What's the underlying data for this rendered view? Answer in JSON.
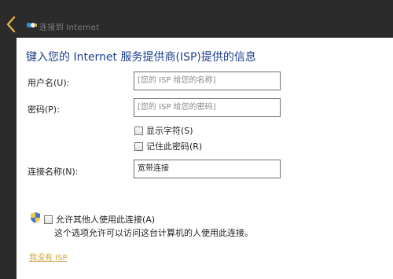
{
  "titlebar": {
    "title": "连接到 Internet"
  },
  "heading": "键入您的 Internet 服务提供商(ISP)提供的信息",
  "form": {
    "username": {
      "label": "用户名(U):",
      "placeholder": "[您的 ISP 给您的名称]"
    },
    "password": {
      "label": "密码(P):",
      "placeholder": "[您的 ISP 给您的密码]"
    },
    "show_chars_label": "显示字符(S)",
    "remember_label": "记住此密码(R)",
    "connection_name": {
      "label": "连接名称(N):",
      "value": "宽带连接"
    }
  },
  "allow_others": {
    "label": "允许其他人使用此连接(A)",
    "note": "这个选项允许可以访问这台计算机的人使用此连接。"
  },
  "no_isp_link": "我没有 ISP",
  "colors": {
    "heading": "#1c3e8c",
    "link": "#d2a442",
    "titlebar": "#2b2b2b"
  }
}
